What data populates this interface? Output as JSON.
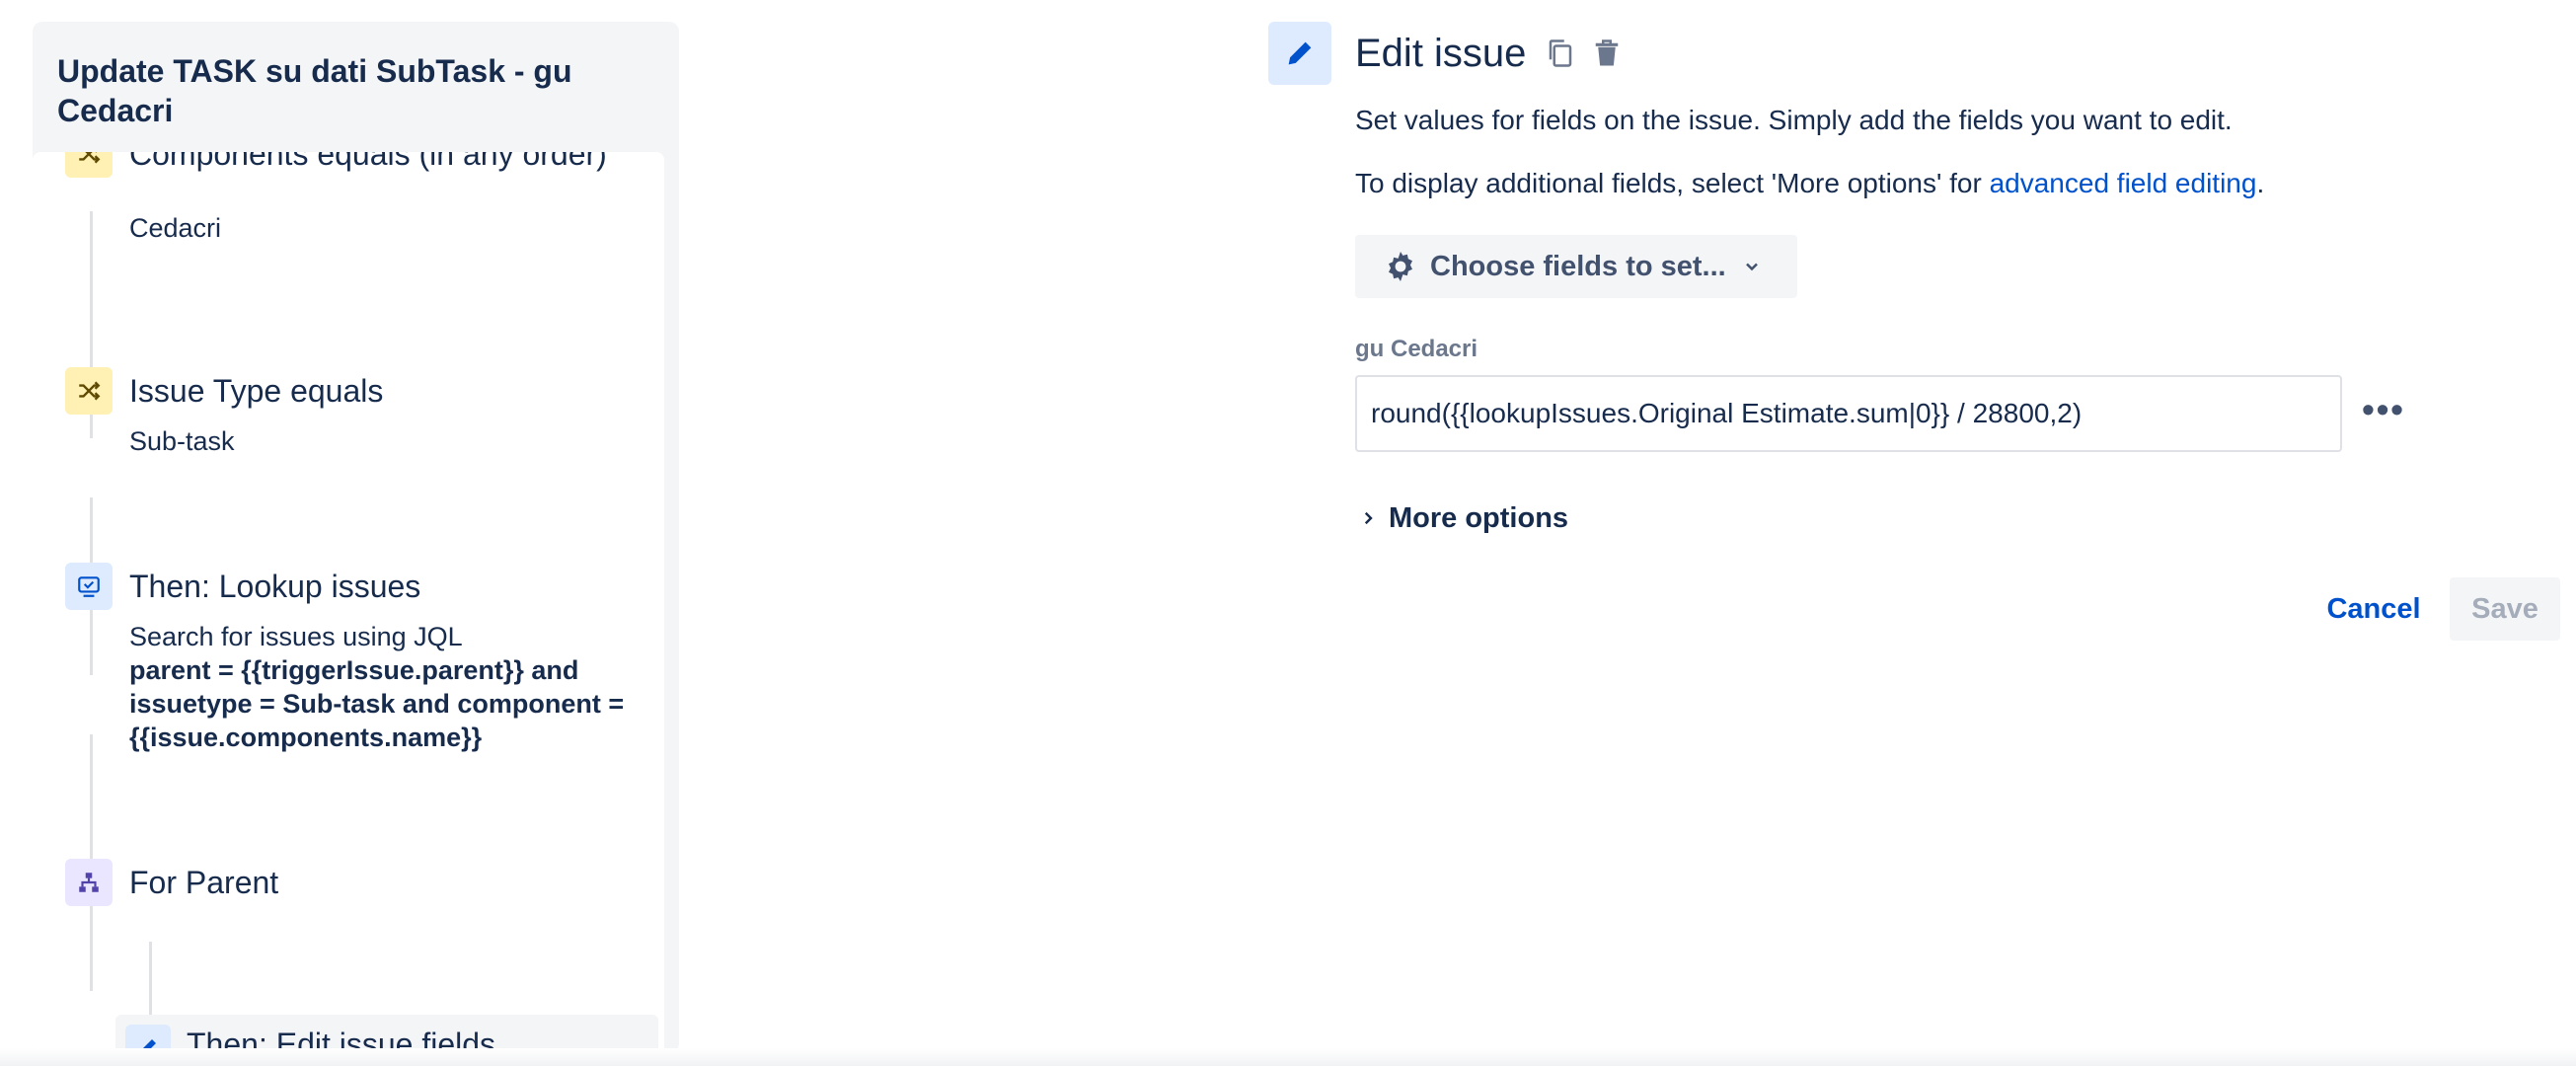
{
  "rule": {
    "title": "Update TASK su dati SubTask - gu Cedacri"
  },
  "steps": [
    {
      "icon": "shuffle-icon",
      "title": "Components equals (in any order)",
      "subtitle": "Cedacri"
    },
    {
      "icon": "shuffle-icon",
      "title": "Issue Type equals",
      "subtitle": "Sub-task"
    },
    {
      "icon": "lookup-icon",
      "title": "Then: Lookup issues",
      "subtitle": "Search for issues using JQL",
      "jql": "parent = {{triggerIssue.parent}} and issuetype = Sub-task and component = {{issue.components.name}}"
    },
    {
      "icon": "hierarchy-icon",
      "title": "For Parent"
    },
    {
      "icon": "pencil-icon",
      "title": "Then: Edit issue fields"
    }
  ],
  "edit": {
    "title": "Edit issue",
    "desc1": "Set values for fields on the issue. Simply add the fields you want to edit.",
    "desc2_prefix": "To display additional fields, select 'More options' for ",
    "desc2_link": "advanced field editing",
    "desc2_suffix": ".",
    "choose_label": "Choose fields to set...",
    "field_label": "gu Cedacri",
    "field_value": "round({{lookupIssues.Original Estimate.sum|0}} / 28800,2)",
    "more_dots": "•••",
    "more_options_label": "More options",
    "cancel_label": "Cancel",
    "save_label": "Save"
  },
  "colors": {
    "accent": "#0052cc",
    "condition_icon_bg": "#fff0b3",
    "action_icon_bg": "#deebff",
    "branch_icon_bg": "#eae6ff"
  }
}
